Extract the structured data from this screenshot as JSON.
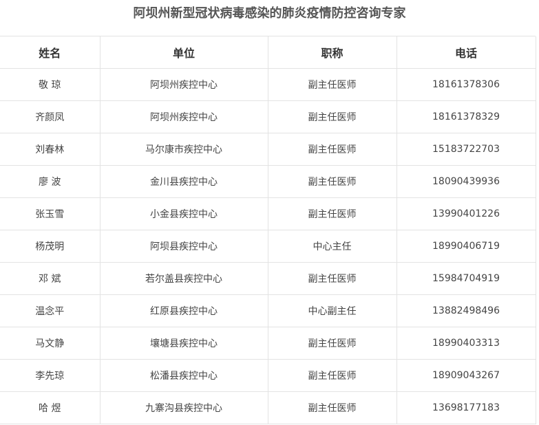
{
  "title": "阿坝州新型冠状病毒感染的肺炎疫情防控咨询专家",
  "table": {
    "headers": [
      "姓名",
      "单位",
      "职称",
      "电话"
    ],
    "rows": [
      [
        "敬 琼",
        "阿坝州疾控中心",
        "副主任医师",
        "18161378306"
      ],
      [
        "齐颜凤",
        "阿坝州疾控中心",
        "副主任医师",
        "18161378329"
      ],
      [
        "刘春林",
        "马尔康市疾控中心",
        "副主任医师",
        "15183722703"
      ],
      [
        "廖 波",
        "金川县疾控中心",
        "副主任医师",
        "18090439936"
      ],
      [
        "张玉雪",
        "小金县疾控中心",
        "副主任医师",
        "13990401226"
      ],
      [
        "杨茂明",
        "阿坝县疾控中心",
        "中心主任",
        "18990406719"
      ],
      [
        "邓 斌",
        "若尔盖县疾控中心",
        "副主任医师",
        "15984704919"
      ],
      [
        "温念平",
        "红原县疾控中心",
        "中心副主任",
        "13882498496"
      ],
      [
        "马文静",
        "壤塘县疾控中心",
        "副主任医师",
        "18990403313"
      ],
      [
        "李先琼",
        "松潘县疾控中心",
        "副主任医师",
        "18909043267"
      ],
      [
        "哈 煜",
        "九寨沟县疾控中心",
        "副主任医师",
        "13698177183"
      ]
    ]
  }
}
